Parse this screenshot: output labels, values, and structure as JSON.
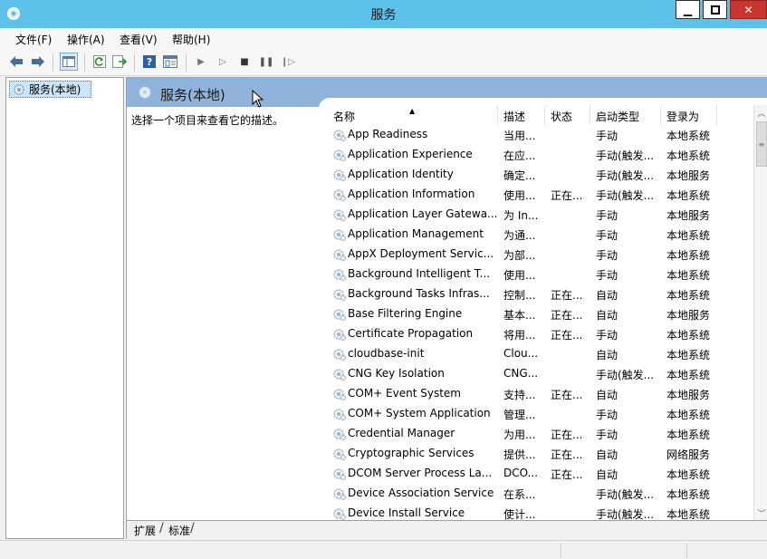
{
  "window": {
    "title": "服务"
  },
  "menu": [
    "文件(F)",
    "操作(A)",
    "查看(V)",
    "帮助(H)"
  ],
  "toolbar_icons": [
    "back-arrow-icon",
    "forward-arrow-icon",
    "show-hide-tree-icon",
    "refresh-icon",
    "export-list-icon",
    "help-icon",
    "properties-icon",
    "start-service-icon",
    "start-service-alt-icon",
    "stop-service-icon",
    "pause-service-icon",
    "resume-service-icon"
  ],
  "tree": {
    "item": "服务(本地)"
  },
  "pane": {
    "title": "服务(本地)",
    "description": "选择一个项目来查看它的描述。"
  },
  "table": {
    "columns": [
      "名称",
      "描述",
      "状态",
      "启动类型",
      "登录为"
    ],
    "rows": [
      {
        "name": "App Readiness",
        "desc": "当用...",
        "status": "",
        "startup": "手动",
        "logon": "本地系统"
      },
      {
        "name": "Application Experience",
        "desc": "在应...",
        "status": "",
        "startup": "手动(触发...",
        "logon": "本地系统"
      },
      {
        "name": "Application Identity",
        "desc": "确定...",
        "status": "",
        "startup": "手动(触发...",
        "logon": "本地服务"
      },
      {
        "name": "Application Information",
        "desc": "使用...",
        "status": "正在...",
        "startup": "手动(触发...",
        "logon": "本地系统"
      },
      {
        "name": "Application Layer Gatewa...",
        "desc": "为 In...",
        "status": "",
        "startup": "手动",
        "logon": "本地服务"
      },
      {
        "name": "Application Management",
        "desc": "为通...",
        "status": "",
        "startup": "手动",
        "logon": "本地系统"
      },
      {
        "name": "AppX Deployment Servic...",
        "desc": "为部...",
        "status": "",
        "startup": "手动",
        "logon": "本地系统"
      },
      {
        "name": "Background Intelligent T...",
        "desc": "使用...",
        "status": "",
        "startup": "手动",
        "logon": "本地系统"
      },
      {
        "name": "Background Tasks Infras...",
        "desc": "控制...",
        "status": "正在...",
        "startup": "自动",
        "logon": "本地系统"
      },
      {
        "name": "Base Filtering Engine",
        "desc": "基本...",
        "status": "正在...",
        "startup": "自动",
        "logon": "本地服务"
      },
      {
        "name": "Certificate Propagation",
        "desc": "将用...",
        "status": "正在...",
        "startup": "手动",
        "logon": "本地系统"
      },
      {
        "name": "cloudbase-init",
        "desc": "Clou...",
        "status": "",
        "startup": "自动",
        "logon": "本地系统"
      },
      {
        "name": "CNG Key Isolation",
        "desc": "CNG...",
        "status": "",
        "startup": "手动(触发...",
        "logon": "本地系统"
      },
      {
        "name": "COM+ Event System",
        "desc": "支持...",
        "status": "正在...",
        "startup": "自动",
        "logon": "本地服务"
      },
      {
        "name": "COM+ System Application",
        "desc": "管理...",
        "status": "",
        "startup": "手动",
        "logon": "本地系统"
      },
      {
        "name": "Credential Manager",
        "desc": "为用...",
        "status": "正在...",
        "startup": "手动",
        "logon": "本地系统"
      },
      {
        "name": "Cryptographic Services",
        "desc": "提供...",
        "status": "正在...",
        "startup": "自动",
        "logon": "网络服务"
      },
      {
        "name": "DCOM Server Process La...",
        "desc": "DCO...",
        "status": "正在...",
        "startup": "自动",
        "logon": "本地系统"
      },
      {
        "name": "Device Association Service",
        "desc": "在系...",
        "status": "",
        "startup": "手动(触发...",
        "logon": "本地系统"
      },
      {
        "name": "Device Install Service",
        "desc": "使计...",
        "status": "",
        "startup": "手动(触发...",
        "logon": "本地系统"
      }
    ]
  },
  "bottom_tabs": [
    "扩展",
    "标准"
  ],
  "colors": {
    "titlebar": "#5ec1ea",
    "pane_header": "#8fb3d9",
    "close": "#c7372f"
  }
}
